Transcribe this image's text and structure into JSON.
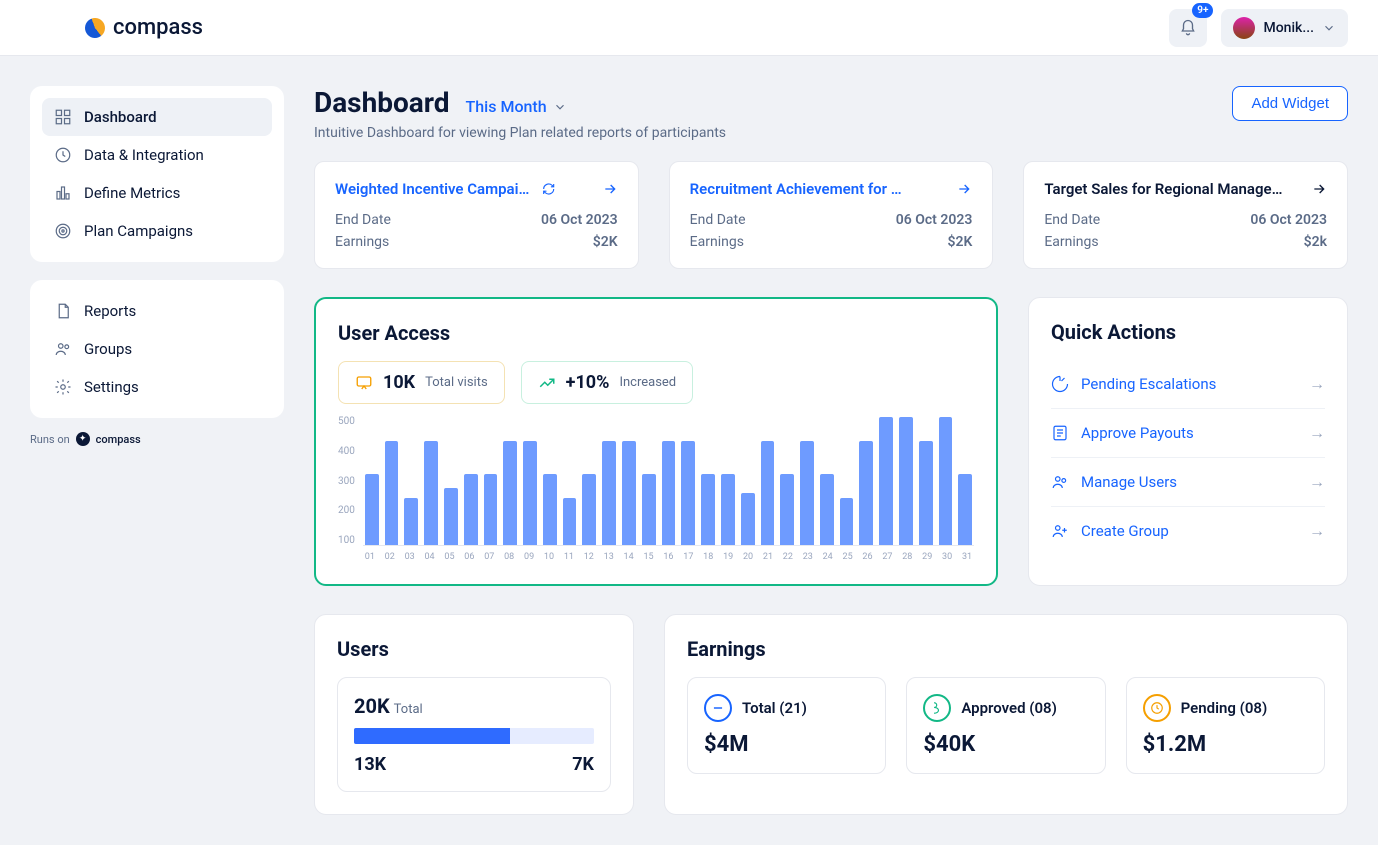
{
  "brand": "compass",
  "notif_badge": "9+",
  "user_name": "Monik...",
  "sidebar": {
    "sec1": [
      {
        "label": "Dashboard",
        "icon": "grid"
      },
      {
        "label": "Data & Integration",
        "icon": "clock"
      },
      {
        "label": "Define Metrics",
        "icon": "bar"
      },
      {
        "label": "Plan Campaigns",
        "icon": "target"
      }
    ],
    "sec2": [
      {
        "label": "Reports",
        "icon": "doc"
      },
      {
        "label": "Groups",
        "icon": "users"
      },
      {
        "label": "Settings",
        "icon": "gear"
      }
    ],
    "runs_on": "Runs on",
    "runs_brand": "compass"
  },
  "header": {
    "title": "Dashboard",
    "period": "This Month",
    "sub": "Intuitive Dashboard for viewing Plan related reports of participants",
    "add_widget": "Add Widget"
  },
  "campaigns": [
    {
      "title": "Weighted Incentive Campaigns",
      "refresh": true,
      "end_label": "End Date",
      "end": "06 Oct 2023",
      "earn_label": "Earnings",
      "earn": "$2K",
      "accent": "blue"
    },
    {
      "title": "Recruitment Achievement for OND...",
      "refresh": false,
      "end_label": "End Date",
      "end": "06 Oct 2023",
      "earn_label": "Earnings",
      "earn": "$2K",
      "accent": "blue"
    },
    {
      "title": "Target Sales for Regional Managers",
      "refresh": false,
      "end_label": "End Date",
      "end": "06 Oct 2023",
      "earn_label": "Earnings",
      "earn": "$2k",
      "accent": "dark"
    }
  ],
  "user_access": {
    "title": "User Access",
    "total_visits_value": "10K",
    "total_visits_label": "Total visits",
    "increase_value": "+10%",
    "increase_label": "Increased"
  },
  "chart_data": {
    "type": "bar",
    "title": "User Access",
    "xlabel": "",
    "ylabel": "",
    "ylim": [
      0,
      550
    ],
    "yticks": [
      100,
      200,
      300,
      400,
      500
    ],
    "categories": [
      "01",
      "02",
      "03",
      "04",
      "05",
      "06",
      "07",
      "08",
      "09",
      "10",
      "11",
      "12",
      "13",
      "14",
      "15",
      "16",
      "17",
      "18",
      "19",
      "20",
      "21",
      "22",
      "23",
      "24",
      "25",
      "26",
      "27",
      "28",
      "29",
      "30",
      "31"
    ],
    "values": [
      300,
      440,
      200,
      440,
      240,
      300,
      300,
      440,
      440,
      300,
      200,
      300,
      440,
      440,
      300,
      440,
      440,
      300,
      300,
      220,
      440,
      300,
      440,
      300,
      200,
      440,
      540,
      540,
      440,
      540,
      300
    ]
  },
  "quick_actions": {
    "title": "Quick Actions",
    "items": [
      {
        "label": "Pending Escalations"
      },
      {
        "label": "Approve Payouts"
      },
      {
        "label": "Manage Users"
      },
      {
        "label": "Create Group"
      }
    ]
  },
  "users_panel": {
    "title": "Users",
    "total_value": "20K",
    "total_label": "Total",
    "progress": 65,
    "left": "13K",
    "right": "7K"
  },
  "earnings_panel": {
    "title": "Earnings",
    "cards": [
      {
        "label": "Total (21)",
        "amount": "$4M",
        "color": "#1764ff"
      },
      {
        "label": "Approved (08)",
        "amount": "$40K",
        "color": "#12b886"
      },
      {
        "label": "Pending (08)",
        "amount": "$1.2M",
        "color": "#f59f00"
      }
    ]
  }
}
